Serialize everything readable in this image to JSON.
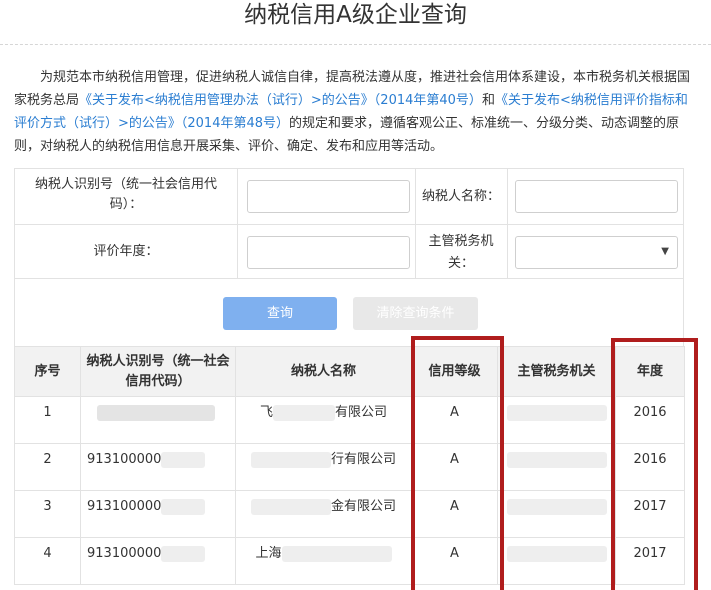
{
  "page_title": "纳税信用A级企业查询",
  "intro": {
    "part1": "为规范本市纳税信用管理，促进纳税人诚信自律，提高税法遵从度，推进社会信用体系建设，本市税务机关根据国家税务总局",
    "link1": "《关于发布<纳税信用管理办法（试行）>的公告》（2014年第40号）",
    "part2": "和",
    "link2": "《关于发布<纳税信用评价指标和评价方式（试行）>的公告》（2014年第48号）",
    "part3": "的规定和要求，遵循客观公正、标准统一、分级分类、动态调整的原则，对纳税人的纳税信用信息开展采集、评价、确定、发布和应用等活动。"
  },
  "search": {
    "taxpayer_id_label": "纳税人识别号（统一社会信用代码）：",
    "taxpayer_name_label": "纳税人名称：",
    "year_label": "评价年度：",
    "tax_office_label": "主管税务机关：",
    "query_button": "查询",
    "clear_button": "清除查询条件"
  },
  "table": {
    "headers": [
      "序号",
      "纳税人识别号（统一社会信用代码）",
      "纳税人名称",
      "信用等级",
      "主管税务机关",
      "年度"
    ],
    "rows": [
      {
        "index": "1",
        "id": "",
        "name": "有限公司",
        "name_prefix": "飞",
        "grade": "A",
        "year": "2016"
      },
      {
        "index": "2",
        "id": "913100000",
        "name": "行有限公司",
        "name_prefix": "",
        "grade": "A",
        "year": "2016"
      },
      {
        "index": "3",
        "id": "913100000",
        "name": "金有限公司",
        "name_prefix": "",
        "grade": "A",
        "year": "2017"
      },
      {
        "index": "4",
        "id": "913100000",
        "name": "",
        "name_prefix": "上海",
        "grade": "A",
        "year": "2017"
      }
    ]
  },
  "colors": {
    "link": "#2a7dd1",
    "query_button": "#7fb0ef",
    "highlight": "#b01d1d"
  }
}
